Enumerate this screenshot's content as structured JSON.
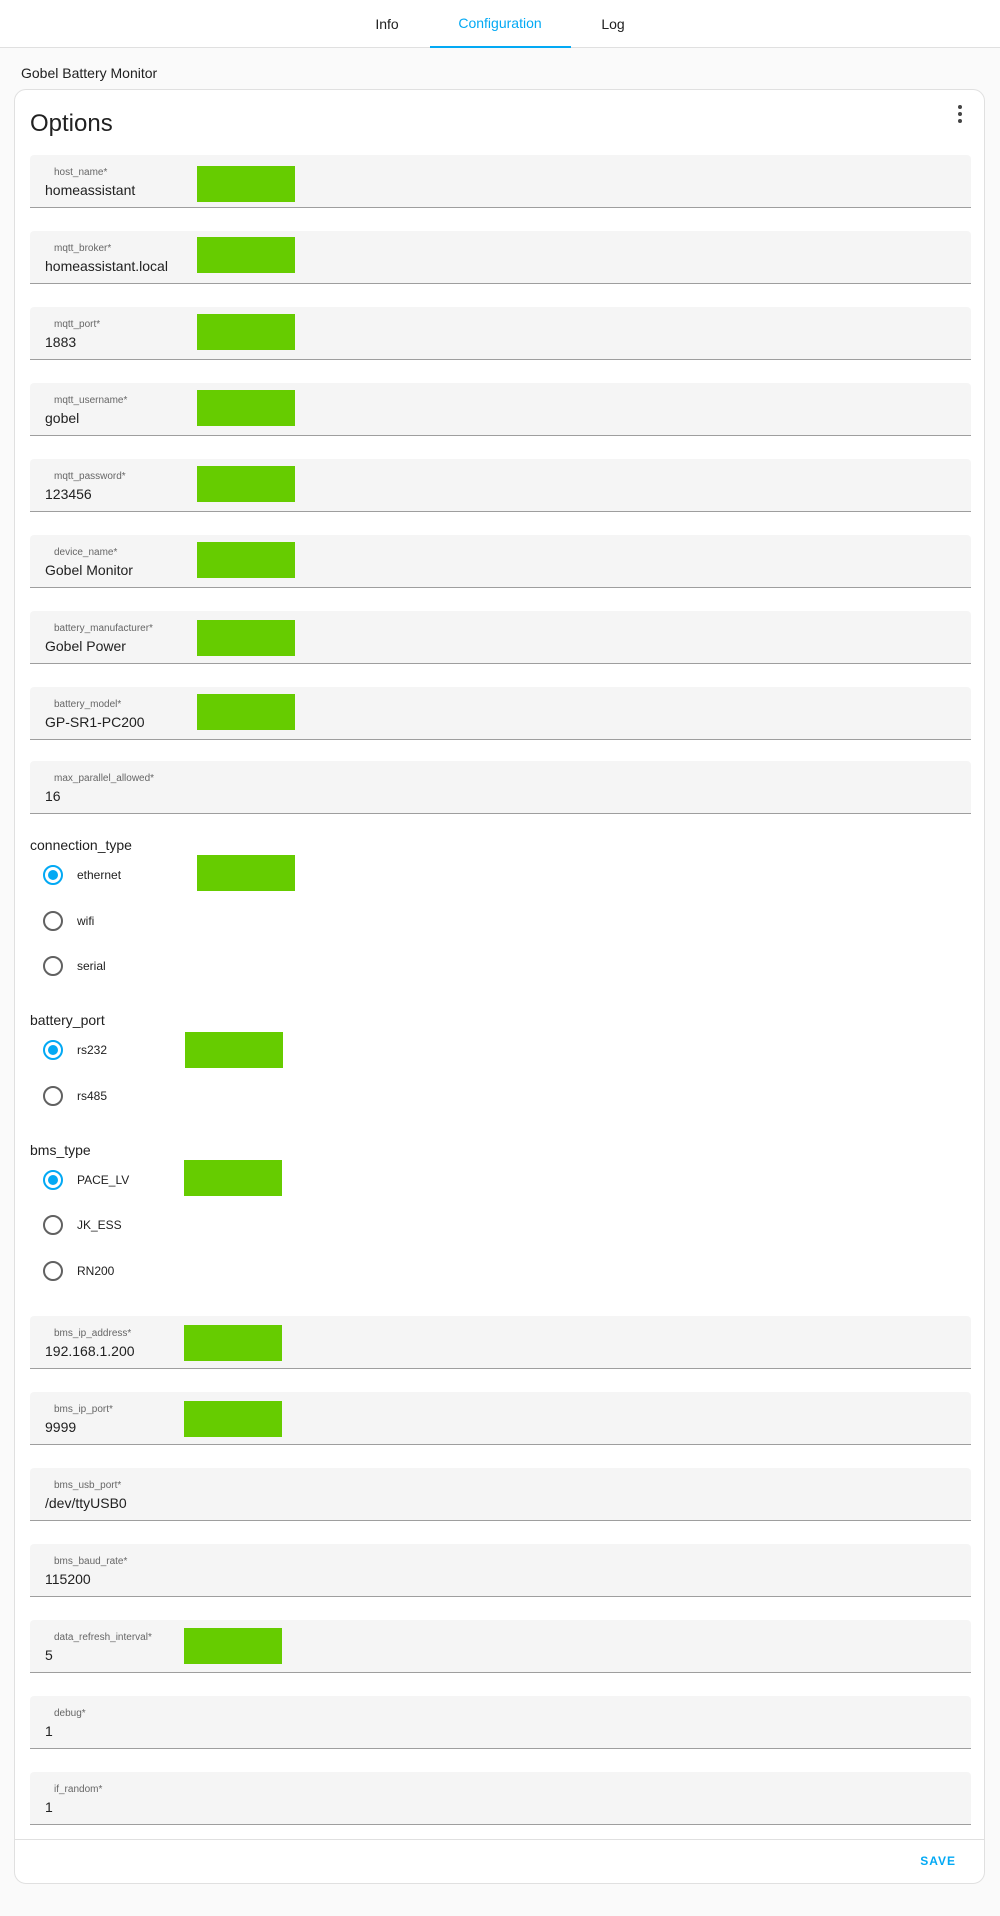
{
  "tabs": {
    "info": "Info",
    "configuration": "Configuration",
    "log": "Log"
  },
  "addon_title": "Gobel Battery Monitor",
  "card": {
    "title": "Options",
    "save_label": "SAVE"
  },
  "fields": {
    "host_name": {
      "label": "host_name*",
      "value": "homeassistant"
    },
    "mqtt_broker": {
      "label": "mqtt_broker*",
      "value": "homeassistant.local"
    },
    "mqtt_port": {
      "label": "mqtt_port*",
      "value": "1883"
    },
    "mqtt_username": {
      "label": "mqtt_username*",
      "value": "gobel"
    },
    "mqtt_password": {
      "label": "mqtt_password*",
      "value": "123456"
    },
    "device_name": {
      "label": "device_name*",
      "value": "Gobel Monitor"
    },
    "battery_manufacturer": {
      "label": "battery_manufacturer*",
      "value": "Gobel Power"
    },
    "battery_model": {
      "label": "battery_model*",
      "value": "GP-SR1-PC200"
    },
    "max_parallel_allowed": {
      "label": "max_parallel_allowed*",
      "value": "16"
    },
    "bms_ip_address": {
      "label": "bms_ip_address*",
      "value": "192.168.1.200"
    },
    "bms_ip_port": {
      "label": "bms_ip_port*",
      "value": "9999"
    },
    "bms_usb_port": {
      "label": "bms_usb_port*",
      "value": "/dev/ttyUSB0"
    },
    "bms_baud_rate": {
      "label": "bms_baud_rate*",
      "value": "115200"
    },
    "data_refresh_interval": {
      "label": "data_refresh_interval*",
      "value": "5"
    },
    "debug": {
      "label": "debug*",
      "value": "1"
    },
    "if_random": {
      "label": "if_random*",
      "value": "1"
    }
  },
  "radio_groups": {
    "connection_type": {
      "title": "connection_type",
      "options": [
        "ethernet",
        "wifi",
        "serial"
      ],
      "selected": "ethernet"
    },
    "battery_port": {
      "title": "battery_port",
      "options": [
        "rs232",
        "rs485"
      ],
      "selected": "rs232"
    },
    "bms_type": {
      "title": "bms_type",
      "options": [
        "PACE_LV",
        "JK_ESS",
        "RN200"
      ],
      "selected": "PACE_LV"
    }
  },
  "colors": {
    "accent": "#03a9f4",
    "redaction": "#66cc00"
  }
}
